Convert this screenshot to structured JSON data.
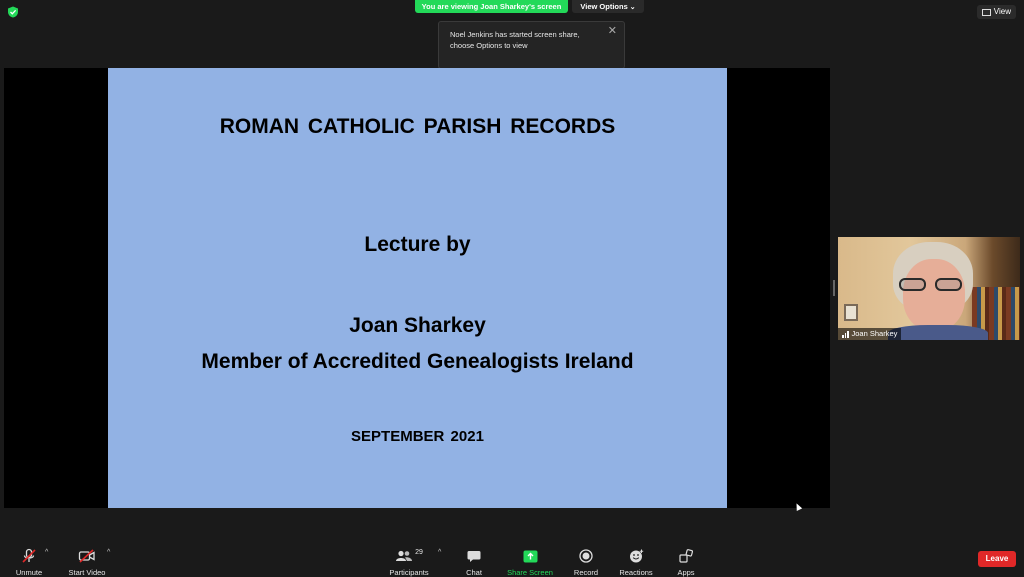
{
  "top_bar": {
    "viewing_banner": "You are viewing Joan Sharkey's screen",
    "view_options_label": "View Options",
    "view_button_label": "View"
  },
  "notification": {
    "line1": "Noel Jenkins has started screen share,",
    "line2": "choose Options to view"
  },
  "slide": {
    "title": "ROMAN  CATHOLIC  PARISH  RECORDS",
    "lecture_by": "Lecture by",
    "presenter": "Joan  Sharkey",
    "affiliation": "Member of Accredited Genealogists Ireland",
    "date": "SEPTEMBER  2021",
    "background_color": "#92b2e4"
  },
  "participant_video": {
    "name": "Joan Sharkey"
  },
  "toolbar": {
    "unmute": "Unmute",
    "start_video": "Start Video",
    "participants": "Participants",
    "participants_count": "29",
    "chat": "Chat",
    "share_screen": "Share Screen",
    "record": "Record",
    "reactions": "Reactions",
    "apps": "Apps",
    "leave": "Leave"
  },
  "colors": {
    "banner_green": "#23d959",
    "leave_red": "#e02828",
    "share_green": "#23d959"
  }
}
